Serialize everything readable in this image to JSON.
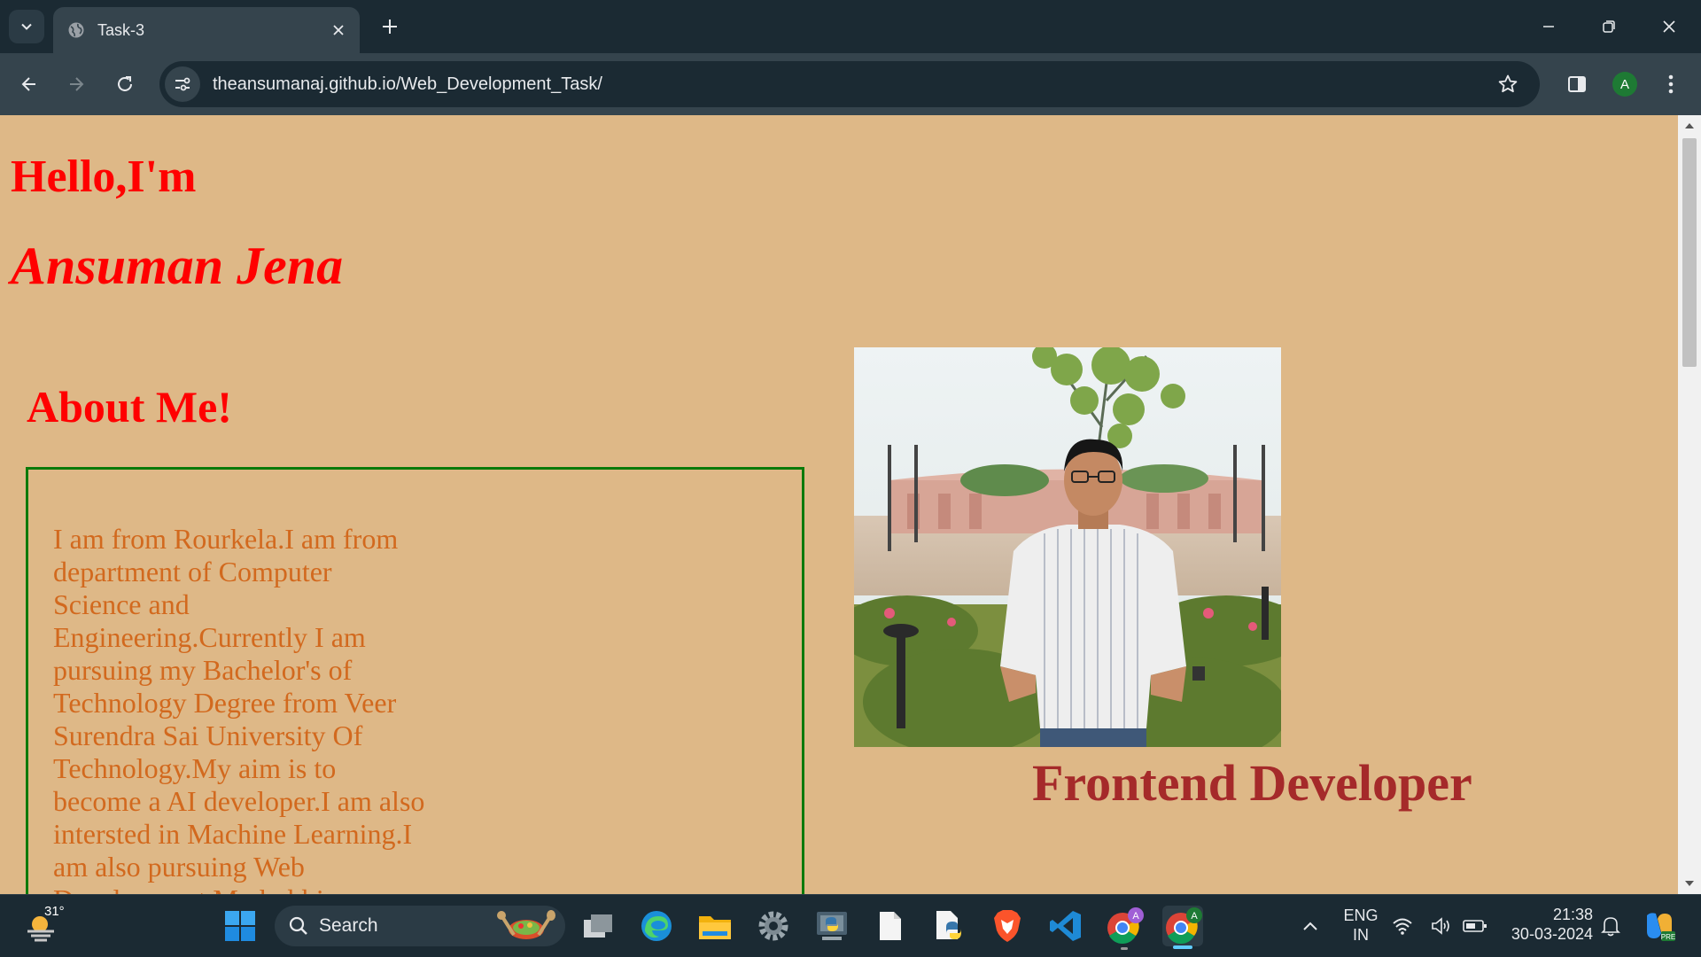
{
  "browser": {
    "tab": {
      "title": "Task-3"
    },
    "address_bar": {
      "url": "theansumanaj.github.io/Web_Development_Task/"
    },
    "profile_initial": "A"
  },
  "page": {
    "greeting": "Hello,I'm",
    "name": "Ansuman Jena",
    "about_heading": "About Me!",
    "about_text": "I am from Rourkela.I am from department of Computer Science and Engineering.Currently I am pursuing my Bachelor's of Technology Degree from Veer Surendra Sai University Of Technology.My aim is to become a AI developer.I am also intersted in Machine Learning.I am also pursuing Web Development.My hobbies",
    "role": "Frontend Developer",
    "colors": {
      "background": "#deb887",
      "heading": "#ff0000",
      "about_text": "#d2691e",
      "about_border": "#0a7a0a",
      "role": "#a52a2a"
    }
  },
  "taskbar": {
    "weather_temp": "31°",
    "search_placeholder": "Search",
    "apps": [
      "windows-start-icon",
      "task-view-icon",
      "edge-icon",
      "file-explorer-icon",
      "settings-icon",
      "python-installer-icon",
      "file-icon",
      "python-file-icon",
      "brave-icon",
      "vscode-icon",
      "chrome-profile-icon",
      "chrome-active-icon"
    ],
    "language": {
      "line1": "ENG",
      "line2": "IN"
    },
    "time": "21:38",
    "date": "30-03-2024"
  }
}
